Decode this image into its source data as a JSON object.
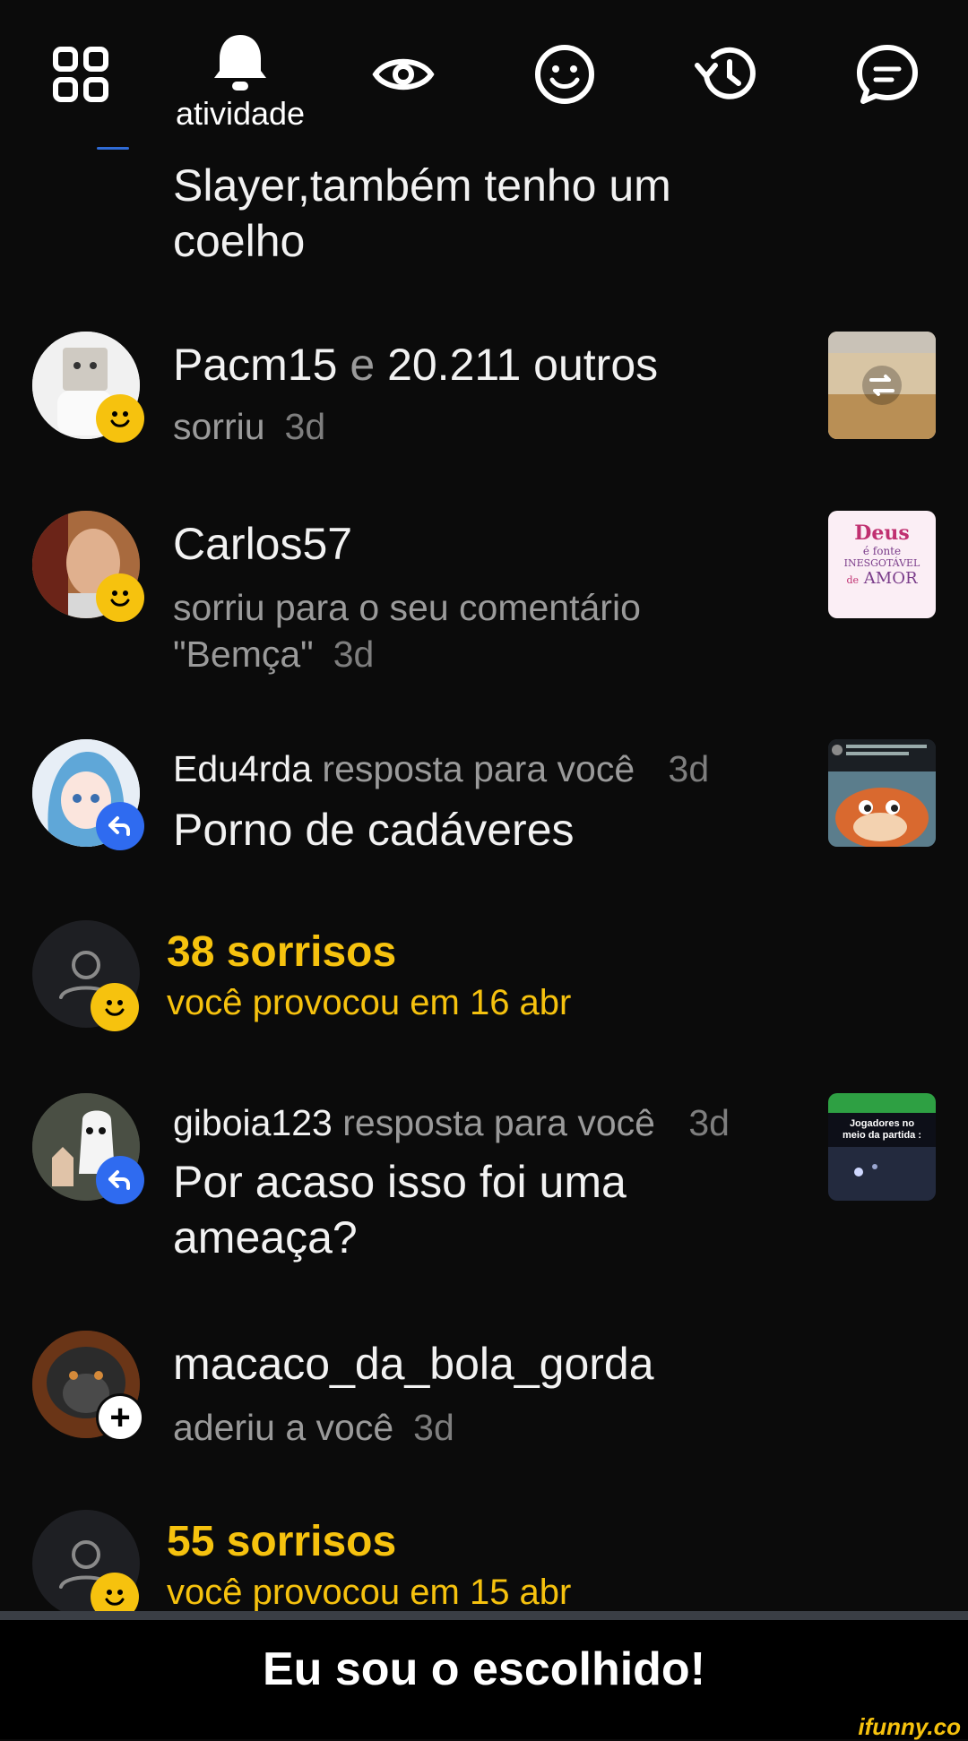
{
  "nav": {
    "tabs": [
      {
        "icon": "grid-icon"
      },
      {
        "icon": "bell-icon",
        "label": "atividade",
        "active": true
      },
      {
        "icon": "eye-icon"
      },
      {
        "icon": "smiley-icon"
      },
      {
        "icon": "history-icon"
      },
      {
        "icon": "chat-icon"
      }
    ],
    "active_label": "atividade"
  },
  "feed": {
    "partial_text": "Slayer,também tenho um coelho",
    "items": [
      {
        "user": "Pacm15",
        "connector": "e",
        "others": "20.211 outros",
        "action": "sorriu",
        "time": "3d",
        "badge": "smile"
      },
      {
        "user": "Carlos57",
        "action": "sorriu para o seu comentário \"Bemça\"",
        "time": "3d",
        "badge": "smile",
        "thumb_text": [
          "Deus",
          "é fonte",
          "INESGOTÁVEL",
          "de",
          "AMOR"
        ]
      },
      {
        "user": "Edu4rda",
        "action": "resposta para você",
        "time": "3d",
        "text": "Porno de cadáveres",
        "badge": "reply"
      },
      {
        "title": "38 sorrisos",
        "subtitle": "você provocou em 16 abr",
        "badge": "smile"
      },
      {
        "user": "giboia123",
        "action": "resposta para você",
        "time": "3d",
        "text": "Por acaso isso foi uma ameaça?",
        "badge": "reply",
        "thumb_text": "Jogadores no meio da partida :"
      },
      {
        "user": "macaco_da_bola_gorda",
        "action": "aderiu a você",
        "time": "3d",
        "badge": "add"
      },
      {
        "title": "55 sorrisos",
        "subtitle": "você provocou em 15 abr",
        "badge": "smile"
      }
    ]
  },
  "caption": "Eu sou o escolhido!",
  "watermark": "ifunny.co",
  "colors": {
    "accent_yellow": "#f6c20e",
    "reply_blue": "#2f6bf0",
    "background": "#0b0b0b"
  }
}
